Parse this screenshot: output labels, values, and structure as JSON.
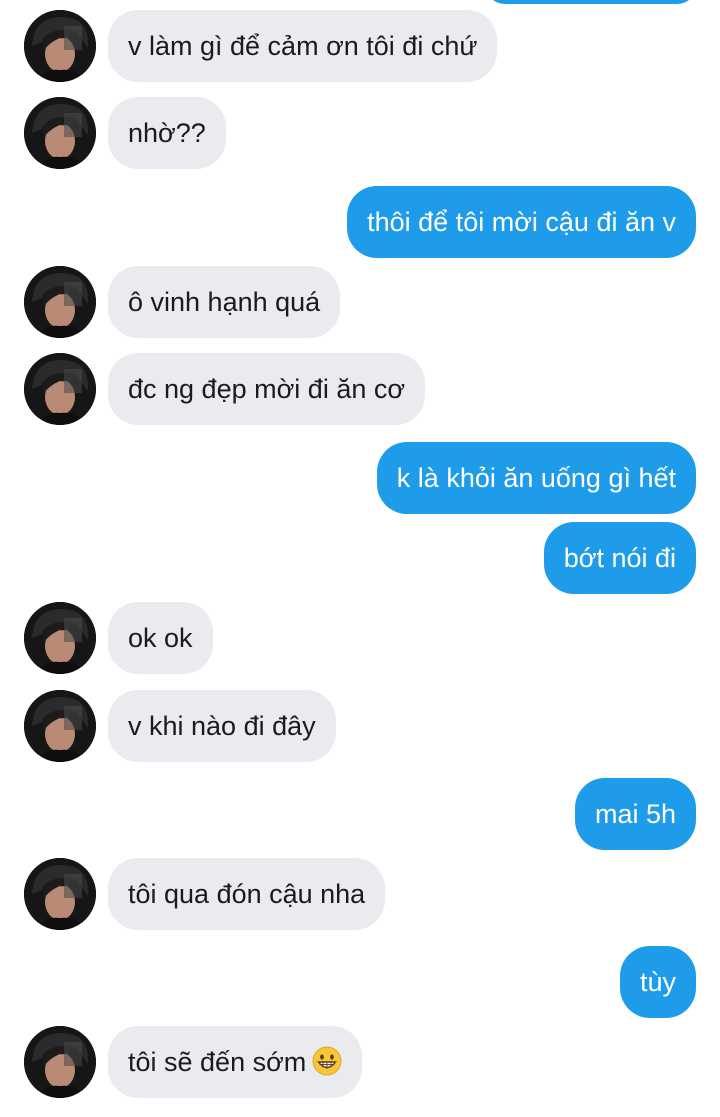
{
  "conversation": {
    "messages": [
      {
        "side": "in",
        "text": "v làm gì để cảm ơn tôi đi chứ"
      },
      {
        "side": "in",
        "text": "nhờ??"
      },
      {
        "side": "out",
        "text": "thôi để tôi mời cậu đi ăn v"
      },
      {
        "side": "in",
        "text": "ô vinh hạnh quá"
      },
      {
        "side": "in",
        "text": "đc ng đẹp mời đi ăn cơ"
      },
      {
        "side": "out",
        "text": "k là khỏi ăn uống gì hết"
      },
      {
        "side": "out",
        "text": "bớt nói đi"
      },
      {
        "side": "in",
        "text": "ok ok"
      },
      {
        "side": "in",
        "text": "v khi nào đi đây"
      },
      {
        "side": "out",
        "text": "mai 5h"
      },
      {
        "side": "in",
        "text": "tôi qua đón cậu nha"
      },
      {
        "side": "out",
        "text": "tùy"
      },
      {
        "side": "in",
        "text": "tôi sẽ đến sớm",
        "emoji": "grinning-face-icon"
      }
    ]
  },
  "colors": {
    "incoming_bubble": "#e9ebee",
    "outgoing_bubble": "#1e9be9",
    "incoming_text": "#1b1b1b",
    "outgoing_text": "#ffffff"
  }
}
